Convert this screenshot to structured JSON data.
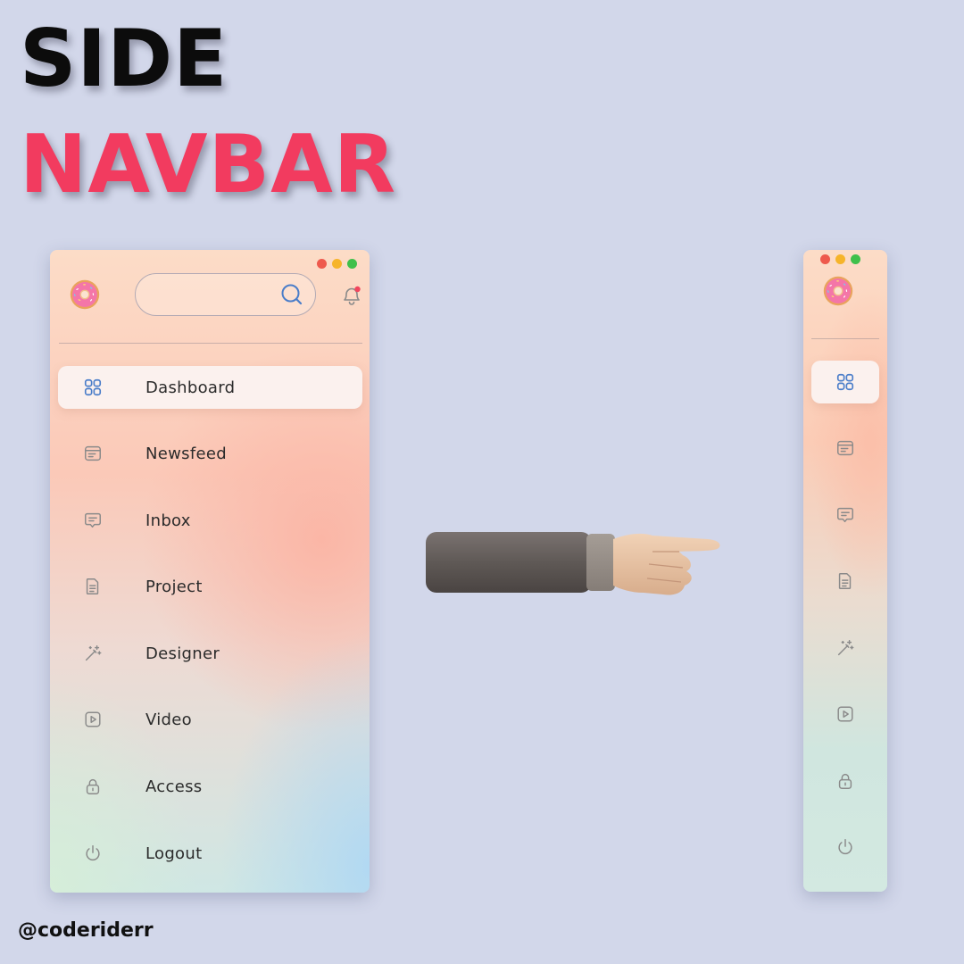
{
  "headline": {
    "line1": "SIDE",
    "line2": "NAVBAR"
  },
  "colors": {
    "background": "#d2d7ea",
    "headline_primary": "#0c0c0c",
    "headline_accent": "#f23b5f",
    "active_icon": "#4a7dc9",
    "inactive_icon": "#8a8a8a"
  },
  "expanded_navbar": {
    "logo_icon": "donut-icon",
    "search": {
      "value": "",
      "placeholder": "",
      "icon": "search-icon"
    },
    "notification_icon": "bell-icon",
    "items": [
      {
        "label": "Dashboard",
        "icon": "grid-icon",
        "active": true
      },
      {
        "label": "Newsfeed",
        "icon": "newsfeed-icon",
        "active": false
      },
      {
        "label": "Inbox",
        "icon": "message-icon",
        "active": false
      },
      {
        "label": "Project",
        "icon": "document-icon",
        "active": false
      },
      {
        "label": "Designer",
        "icon": "magic-wand-icon",
        "active": false
      },
      {
        "label": "Video",
        "icon": "play-icon",
        "active": false
      },
      {
        "label": "Access",
        "icon": "lock-icon",
        "active": false
      },
      {
        "label": "Logout",
        "icon": "power-icon",
        "active": false
      }
    ]
  },
  "collapsed_navbar": {
    "logo_icon": "donut-icon",
    "items": [
      {
        "icon": "grid-icon",
        "active": true
      },
      {
        "icon": "newsfeed-icon",
        "active": false
      },
      {
        "icon": "message-icon",
        "active": false
      },
      {
        "icon": "document-icon",
        "active": false
      },
      {
        "icon": "magic-wand-icon",
        "active": false
      },
      {
        "icon": "play-icon",
        "active": false
      },
      {
        "icon": "lock-icon",
        "active": false
      },
      {
        "icon": "power-icon",
        "active": false
      }
    ]
  },
  "pointer_icon": "pointing-hand-icon",
  "footer": {
    "handle": "@coderiderr"
  }
}
